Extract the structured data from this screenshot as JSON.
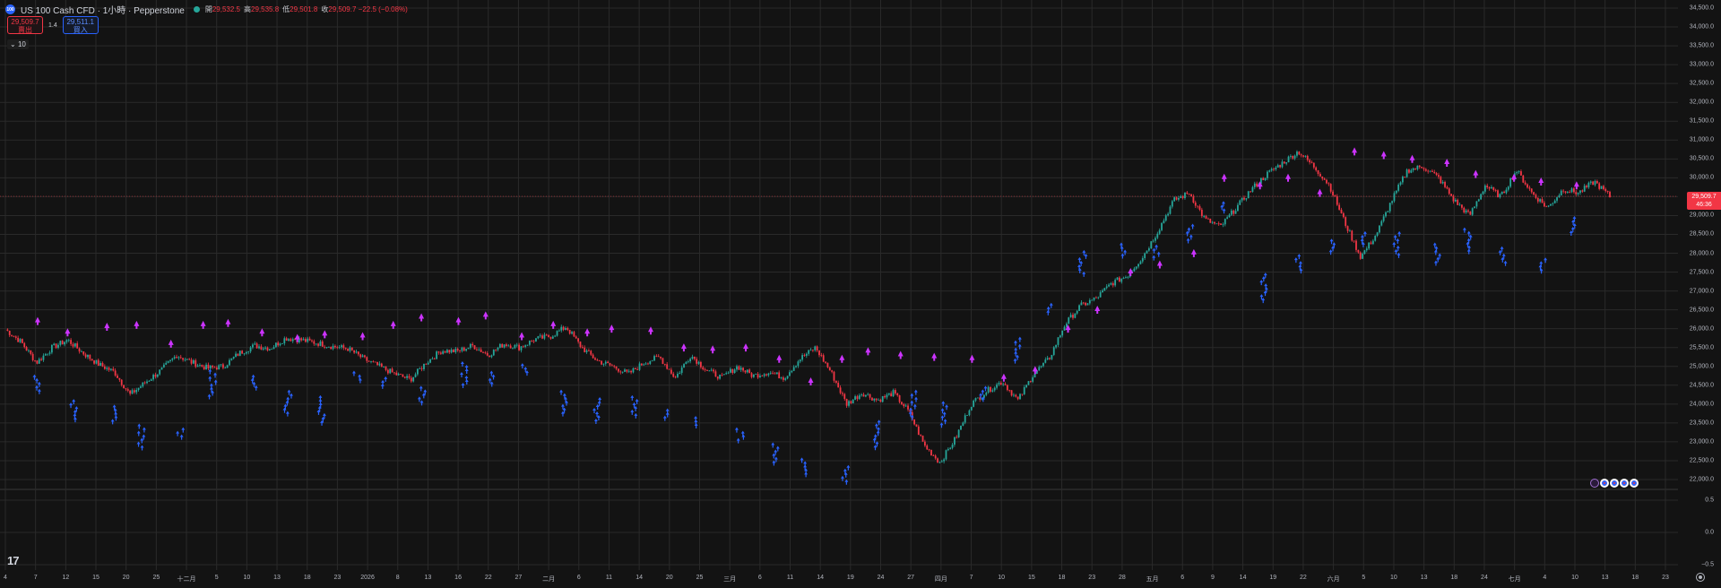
{
  "header": {
    "logo": "100",
    "symbol": "US 100 Cash CFD · 1小時 · Pepperstone",
    "ohlc": [
      {
        "label": "開",
        "value": "29,532.5"
      },
      {
        "label": "高",
        "value": "29,535.8"
      },
      {
        "label": "低",
        "value": "29,501.8"
      },
      {
        "label": "收",
        "value": "29,509.7 −22.5 (−0.08%)"
      }
    ]
  },
  "trade": {
    "sell_price": "29,509.7",
    "sell_label": "賣出",
    "spread": "1.4",
    "buy_price": "29,511.1",
    "buy_label": "買入"
  },
  "indicators_toggle": "10",
  "colors": {
    "up": "#26a69a",
    "down": "#f23645",
    "buy_arrow": "#2962ff",
    "sell_arrow": "#cc33ff",
    "grid": "#2a2a2a"
  },
  "price_axis": {
    "labels": [
      "34,500.0",
      "34,000.0",
      "33,500.0",
      "33,000.0",
      "32,500.0",
      "32,000.0",
      "31,500.0",
      "31,000.0",
      "30,500.0",
      "30,000.0",
      "29,500.0",
      "29,000.0",
      "28,500.0",
      "28,000.0",
      "27,500.0",
      "27,000.0",
      "26,500.0",
      "26,000.0",
      "25,500.0",
      "25,000.0",
      "24,500.0",
      "24,000.0",
      "23,500.0",
      "23,000.0",
      "22,500.0",
      "22,000.0",
      "0.5",
      "0.0",
      "−0.5"
    ],
    "current_price": "29,509.7",
    "countdown": "46:36"
  },
  "time_axis": {
    "labels": [
      "4",
      "7",
      "12",
      "15",
      "20",
      "25",
      "十二月",
      "5",
      "10",
      "13",
      "18",
      "23",
      "2026",
      "8",
      "13",
      "16",
      "22",
      "27",
      "二月",
      "6",
      "11",
      "14",
      "20",
      "25",
      "三月",
      "6",
      "11",
      "14",
      "19",
      "24",
      "27",
      "四月",
      "7",
      "10",
      "15",
      "18",
      "23",
      "28",
      "五月",
      "6",
      "9",
      "14",
      "19",
      "22",
      "六月",
      "5",
      "10",
      "13",
      "18",
      "24",
      "七月",
      "4",
      "10",
      "13",
      "18",
      "23"
    ]
  },
  "chart_data": {
    "type": "line",
    "title": "US 100 Cash CFD · 1小時 · Pepperstone",
    "xlabel": "",
    "ylabel": "",
    "ylim": [
      21700,
      34600
    ],
    "series": [
      {
        "values": [
          25980,
          25650,
          25100,
          25500,
          25700,
          25350,
          25050,
          24850,
          24250,
          24580,
          24900,
          25300,
          25100,
          24950,
          25000,
          25350,
          25550,
          25480,
          25750,
          25700,
          25620,
          25530,
          25470,
          25200,
          25000,
          24800,
          24650,
          25100,
          25420,
          25400,
          25550,
          25300,
          25600,
          25500,
          25720,
          25800,
          26050,
          25500,
          25150,
          25000,
          24800,
          25100,
          25250,
          24700,
          25300,
          24900,
          24700,
          25000,
          24750,
          24850,
          24700,
          25200,
          25500,
          24850,
          24000,
          24300,
          24100,
          24300,
          23800,
          22900,
          22450,
          23100,
          24000,
          24350,
          24600,
          24100,
          24800,
          25200,
          26100,
          26600,
          26800,
          27200,
          27400,
          27900,
          28600,
          29400,
          29600,
          28900,
          28700,
          29200,
          29700,
          30100,
          30400,
          30700,
          30300,
          29800,
          28800,
          27900,
          28500,
          29400,
          30200,
          30300,
          30000,
          29400,
          29000,
          29800,
          29500,
          30200,
          29600,
          29200,
          29700,
          29600,
          29900,
          29510
        ]
      }
    ],
    "sell_signals": [
      26000,
      25700,
      25850,
      25900,
      25400,
      25900,
      25950,
      25700,
      25550,
      25650,
      25600,
      25900,
      26100,
      26000,
      26150,
      25600,
      25900,
      25700,
      25800,
      25750,
      25300,
      25250,
      25300,
      25000,
      24400,
      25000,
      25200,
      25100,
      25050,
      25000,
      24500,
      24700,
      25800,
      26300,
      27300,
      27500,
      27800,
      29800,
      29600,
      29800,
      29400,
      30500,
      30400,
      30300,
      30200,
      29900,
      29800,
      29700,
      29600
    ],
    "buy_signals": [
      25000,
      24350,
      24200,
      23700,
      23600,
      25150,
      25000,
      24600,
      24450,
      25100,
      24950,
      24700,
      25350,
      25100,
      25300,
      24600,
      24400,
      24450,
      24100,
      23900,
      23600,
      23200,
      22800,
      22600,
      23800,
      24600,
      24300,
      24700,
      26000,
      26900,
      28300,
      28500,
      28450,
      29000,
      29600,
      27700,
      28200,
      28600,
      28800,
      28800,
      28500,
      28900,
      28400,
      28100,
      29200
    ]
  }
}
